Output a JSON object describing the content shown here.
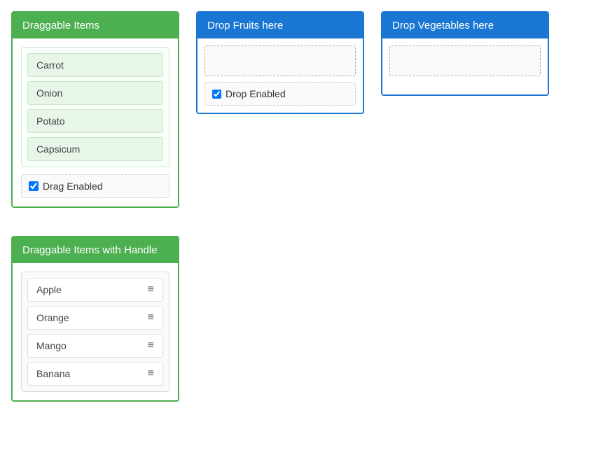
{
  "draggable_panel": {
    "title": "Draggable Items",
    "items": [
      "Carrot",
      "Onion",
      "Potato",
      "Capsicum"
    ],
    "drag_enabled_label": "Drag Enabled",
    "drag_enabled_checked": true
  },
  "drop_fruits_panel": {
    "title": "Drop Fruits here",
    "drop_enabled_label": "Drop Enabled",
    "drop_enabled_checked": true
  },
  "drop_vegetables_panel": {
    "title": "Drop Vegetables here"
  },
  "handle_panel": {
    "title": "Draggable Items with Handle",
    "items": [
      "Apple",
      "Orange",
      "Mango",
      "Banana"
    ],
    "handle_icon": "≡"
  }
}
